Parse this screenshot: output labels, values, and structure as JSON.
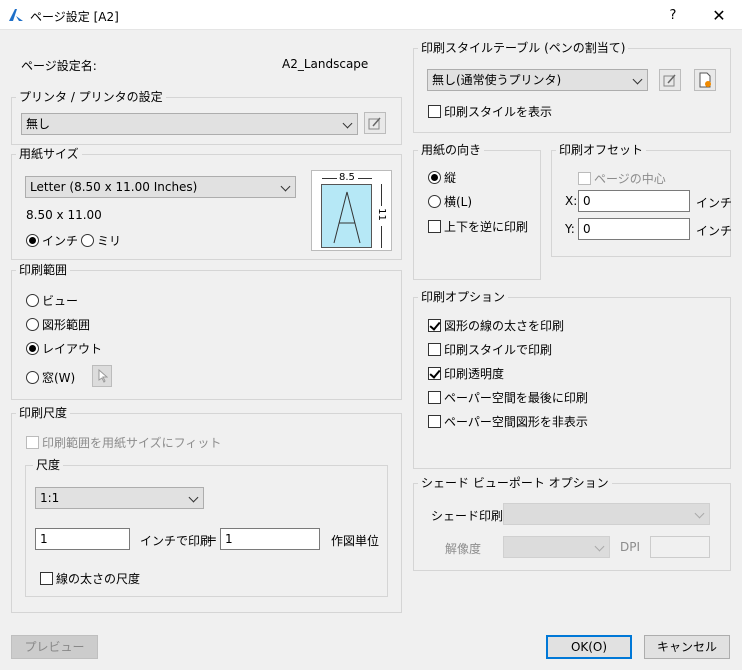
{
  "window": {
    "title": "ページ設定 [A2]",
    "help": "?",
    "close": "✕"
  },
  "page_setup_name": {
    "label": "ページ設定名:",
    "value": "A2_Landscape"
  },
  "printer": {
    "legend": "プリンタ / プリンタの設定",
    "selected": "無し"
  },
  "paper": {
    "legend": "用紙サイズ",
    "selected": "Letter (8.50 x 11.00 Inches)",
    "size_text": "8.50 x 11.00",
    "unit_inch": "インチ",
    "unit_mm": "ミリ",
    "preview_width": "8.5",
    "preview_height": "11",
    "preview_letter": "A"
  },
  "plot_area": {
    "legend": "印刷範囲",
    "options": [
      "ビュー",
      "図形範囲",
      "レイアウト",
      "窓(W)"
    ],
    "selected": "レイアウト"
  },
  "plot_scale": {
    "legend": "印刷尺度",
    "fit_label": "印刷範囲を用紙サイズにフィット",
    "scale_legend": "尺度",
    "scale_selected": "1:1",
    "inch_value": "1",
    "inch_label": "インチで印刷",
    "equals": "=",
    "unit_value": "1",
    "unit_label": "作図単位",
    "lineweight_label": "線の太さの尺度"
  },
  "plot_style_table": {
    "legend": "印刷スタイルテーブル (ペンの割当て)",
    "selected": "無し(通常使うプリンタ)",
    "display_label": "印刷スタイルを表示"
  },
  "orientation": {
    "legend": "用紙の向き",
    "portrait": "縦",
    "landscape": "横(L)",
    "upside_down": "上下を逆に印刷"
  },
  "plot_offset": {
    "legend": "印刷オフセット",
    "center_label": "ページの中心",
    "x_label": "X:",
    "x_value": "0",
    "x_unit": "インチ",
    "y_label": "Y:",
    "y_value": "0",
    "y_unit": "インチ"
  },
  "plot_options": {
    "legend": "印刷オプション",
    "items": [
      {
        "label": "図形の線の太さを印刷",
        "checked": true
      },
      {
        "label": "印刷スタイルで印刷",
        "checked": false
      },
      {
        "label": "印刷透明度",
        "checked": true
      },
      {
        "label": "ペーパー空間を最後に印刷",
        "checked": false
      },
      {
        "label": "ペーパー空間図形を非表示",
        "checked": false
      }
    ]
  },
  "shaded_viewport": {
    "legend": "シェード ビューポート オプション",
    "shade_label": "シェード印刷",
    "quality_label": "解像度",
    "dpi_label": "DPI"
  },
  "buttons": {
    "preview": "プレビュー",
    "ok": "OK(O)",
    "cancel": "キャンセル"
  }
}
